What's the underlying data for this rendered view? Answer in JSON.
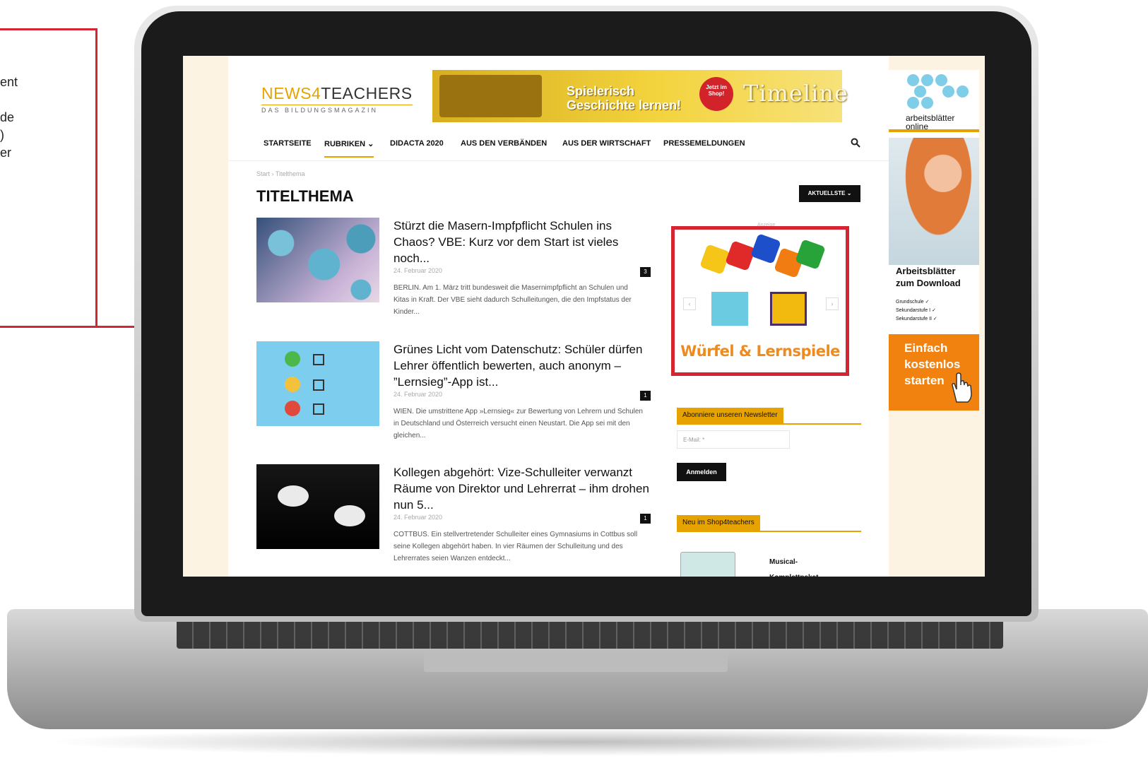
{
  "callout": {
    "lines": [
      "ent",
      "",
      "de",
      ")",
      "er"
    ]
  },
  "site": {
    "logo_prefix": "NEWS",
    "logo_number": "4",
    "logo_suffix": "TEACHERS",
    "logo_tagline": "DAS BILDUNGSMAGAZIN"
  },
  "top_ad": {
    "line1": "Spielerisch",
    "line2": "Geschichte lernen!",
    "bubble": "Jetzt im Shop!",
    "brand": "Timeline"
  },
  "nav": {
    "items": [
      "STARTSEITE",
      "RUBRIKEN ⌄",
      "DIDACTA 2020",
      "AUS DEN VERBÄNDEN",
      "AUS DER WIRTSCHAFT",
      "PRESSEMELDUNGEN"
    ]
  },
  "breadcrumb": "Start  ›  Titelthema",
  "page_title": "TITELTHEMA",
  "sort_button": "AKTUELLSTE ⌄",
  "articles": [
    {
      "title": "Stürzt die Masern-Impfpflicht Schulen ins Chaos? VBE: Kurz vor dem Start ist vieles noch...",
      "date": "24. Februar 2020",
      "comments": "3",
      "excerpt": "BERLIN. Am 1. März tritt bundesweit die Masernimpfpflicht an Schulen und Kitas in Kraft. Der VBE sieht dadurch Schulleitungen, die den Impfstatus der Kinder..."
    },
    {
      "title": "Grünes Licht vom Datenschutz: Schüler dürfen Lehrer öffentlich bewerten, auch anonym – ”Lernsieg”-App ist...",
      "date": "24. Februar 2020",
      "comments": "1",
      "excerpt": "WIEN. Die umstrittene App »Lernsieg« zur Bewertung von Lehrern und Schulen in Deutschland und Österreich versucht einen Neustart. Die App sei mit den gleichen..."
    },
    {
      "title": "Kollegen abgehört: Vize-Schulleiter verwanzt Räume von Direktor und Lehrerrat – ihm drohen nun 5...",
      "date": "24. Februar 2020",
      "comments": "1",
      "excerpt": "COTTBUS. Ein stellvertretender Schulleiter eines Gymnasiums in Cottbus soll seine Kollegen abgehört haben. In vier Räumen der Schulleitung und des Lehrerrates  seien Wanzen entdeckt..."
    }
  ],
  "sidebar": {
    "ad_label": "Anzeige",
    "ad_caption": "Würfel & Lernspiele",
    "ad_prev": "‹",
    "ad_next": "›",
    "newsletter_title": "Abonniere unseren Newsletter",
    "email_placeholder": "E-Mail: *",
    "subscribe_button": "Anmelden",
    "shop_title": "Neu im Shop4teachers",
    "shop_item": "Musical-Komplettpaket Die"
  },
  "sky_ad": {
    "brand_line1": "arbeitsblätter",
    "brand_line2": "online",
    "heading_line1": "Arbeitsblätter",
    "heading_line2": "zum Download",
    "list": [
      "Grundschule          ✓",
      "Sekundarstufe I     ✓",
      "Sekundarstufe II    ✓"
    ],
    "cta_line1": "Einfach",
    "cta_line2": "kostenlos",
    "cta_line3": "starten"
  },
  "colors": {
    "accent": "#e6a300",
    "highlight_red": "#d62532",
    "cta_orange": "#f2820f",
    "screen_bg": "#fdf3e3"
  }
}
